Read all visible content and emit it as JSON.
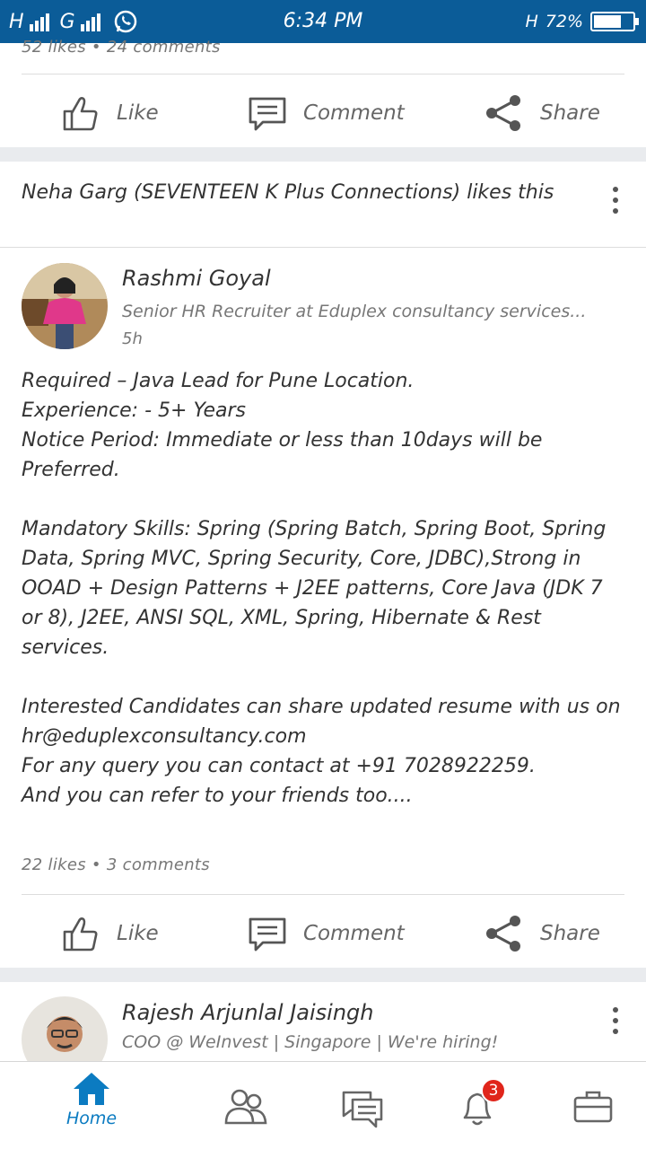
{
  "status_bar": {
    "net1": "H",
    "net2": "G",
    "time": "6:34 PM",
    "net3": "H",
    "battery_text": "72%",
    "battery_level": 0.72,
    "whatsapp_icon": "whatsapp-icon"
  },
  "post_prev": {
    "stats": "52 likes • 24 comments",
    "like_label": "Like",
    "comment_label": "Comment",
    "share_label": "Share"
  },
  "post_main": {
    "social_context": "Neha Garg (SEVENTEEN K Plus Connections) likes this",
    "author": "Rashmi Goyal",
    "headline": "Senior HR Recruiter at Eduplex consultancy services...",
    "time": "5h",
    "body": [
      "Required – Java Lead for Pune Location.",
      "Experience: - 5+ Years",
      "Notice Period: Immediate or less than 10days will be Preferred.",
      "",
      "Mandatory Skills: Spring (Spring Batch, Spring Boot, Spring Data, Spring MVC, Spring Security, Core, JDBC),Strong in OOAD + Design Patterns + J2EE patterns, Core Java (JDK 7 or 8), J2EE, ANSI SQL, XML, Spring, Hibernate & Rest services.",
      "",
      "Interested Candidates can share updated resume with us on hr@eduplexconsultancy.com",
      "For any query you can contact at +91 7028922259.",
      "And you can refer to your friends too...."
    ],
    "stats": "22 likes • 3 comments",
    "like_label": "Like",
    "comment_label": "Comment",
    "share_label": "Share"
  },
  "post_next": {
    "author": "Rajesh Arjunlal Jaisingh",
    "headline": "COO @ WeInvest | Singapore | We're hiring!"
  },
  "bottom_nav": {
    "home_label": "Home",
    "notifications_badge": "3",
    "accent": "#0b7bc1"
  }
}
